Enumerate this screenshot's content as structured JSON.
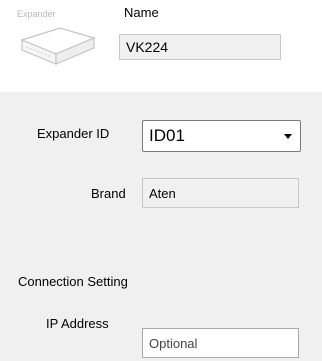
{
  "expander_icon": {
    "name": "expander-device-icon",
    "caption": "Expander"
  },
  "name_section": {
    "label": "Name",
    "value": "VK224"
  },
  "expander_id": {
    "label": "Expander ID",
    "selected": "ID01"
  },
  "brand": {
    "label": "Brand",
    "value": "Aten"
  },
  "connection": {
    "heading": "Connection Setting",
    "ip_label": "IP Address",
    "ip_placeholder": "Optional"
  }
}
